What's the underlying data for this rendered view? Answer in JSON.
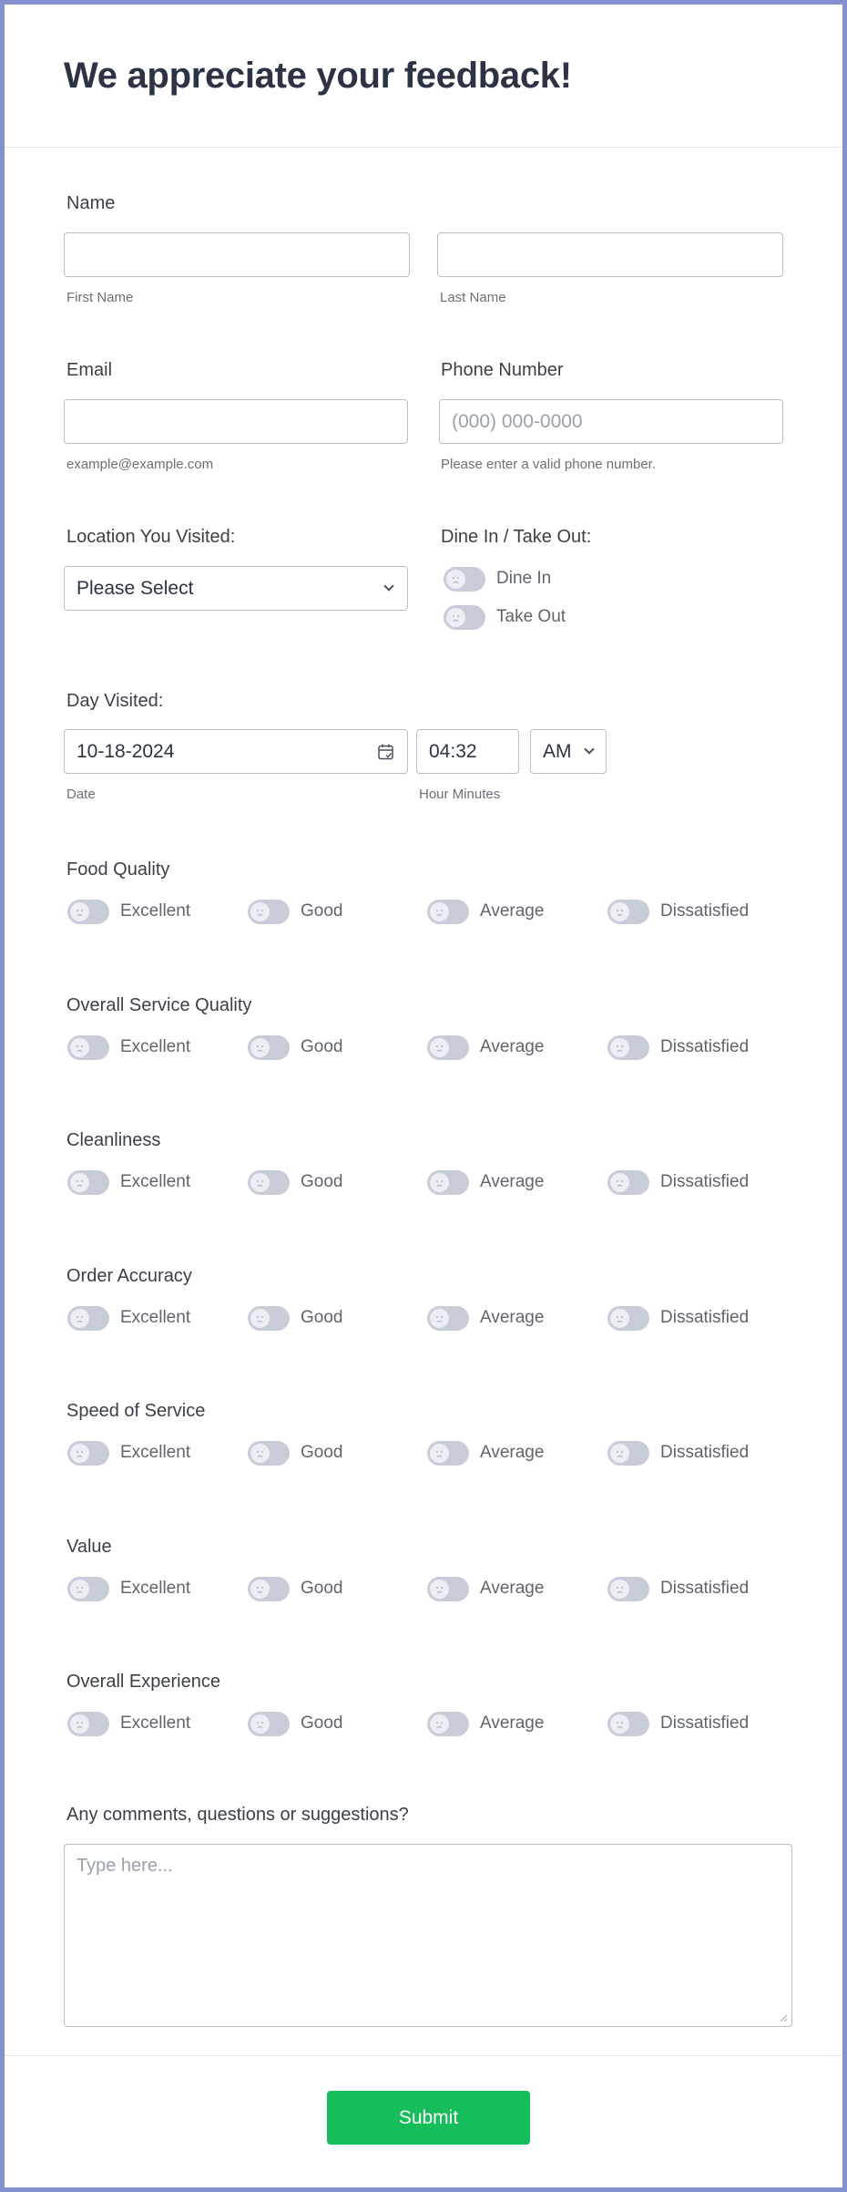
{
  "header": {
    "title": "We appreciate your feedback!"
  },
  "name": {
    "label": "Name",
    "first_value": "",
    "first_sublabel": "First Name",
    "last_value": "",
    "last_sublabel": "Last Name"
  },
  "email": {
    "label": "Email",
    "value": "",
    "sublabel": "example@example.com"
  },
  "phone": {
    "label": "Phone Number",
    "placeholder": "(000) 000-0000",
    "sublabel": "Please enter a valid phone number."
  },
  "location": {
    "label": "Location You Visited:",
    "selected": "Please Select"
  },
  "dine": {
    "label": "Dine In / Take Out:",
    "options": [
      {
        "label": "Dine In",
        "checked": false
      },
      {
        "label": "Take Out",
        "checked": false
      }
    ]
  },
  "day_visited": {
    "label": "Day Visited:",
    "date": "10-18-2024",
    "date_sublabel": "Date",
    "time": "04:32",
    "ampm": "AM",
    "time_sublabel": "Hour Minutes"
  },
  "rating_options": [
    "Excellent",
    "Good",
    "Average",
    "Dissatisfied"
  ],
  "ratings": [
    {
      "label": "Food Quality"
    },
    {
      "label": "Overall Service Quality"
    },
    {
      "label": "Cleanliness"
    },
    {
      "label": "Order Accuracy"
    },
    {
      "label": "Speed of Service"
    },
    {
      "label": "Value"
    },
    {
      "label": "Overall Experience"
    }
  ],
  "comments": {
    "label": "Any comments, questions or suggestions?",
    "placeholder": "Type here...",
    "value": ""
  },
  "submit": {
    "label": "Submit"
  },
  "colors": {
    "frame": "#8590cf",
    "submit": "#18bd5b",
    "toggle_off": "#c8ccd8"
  }
}
